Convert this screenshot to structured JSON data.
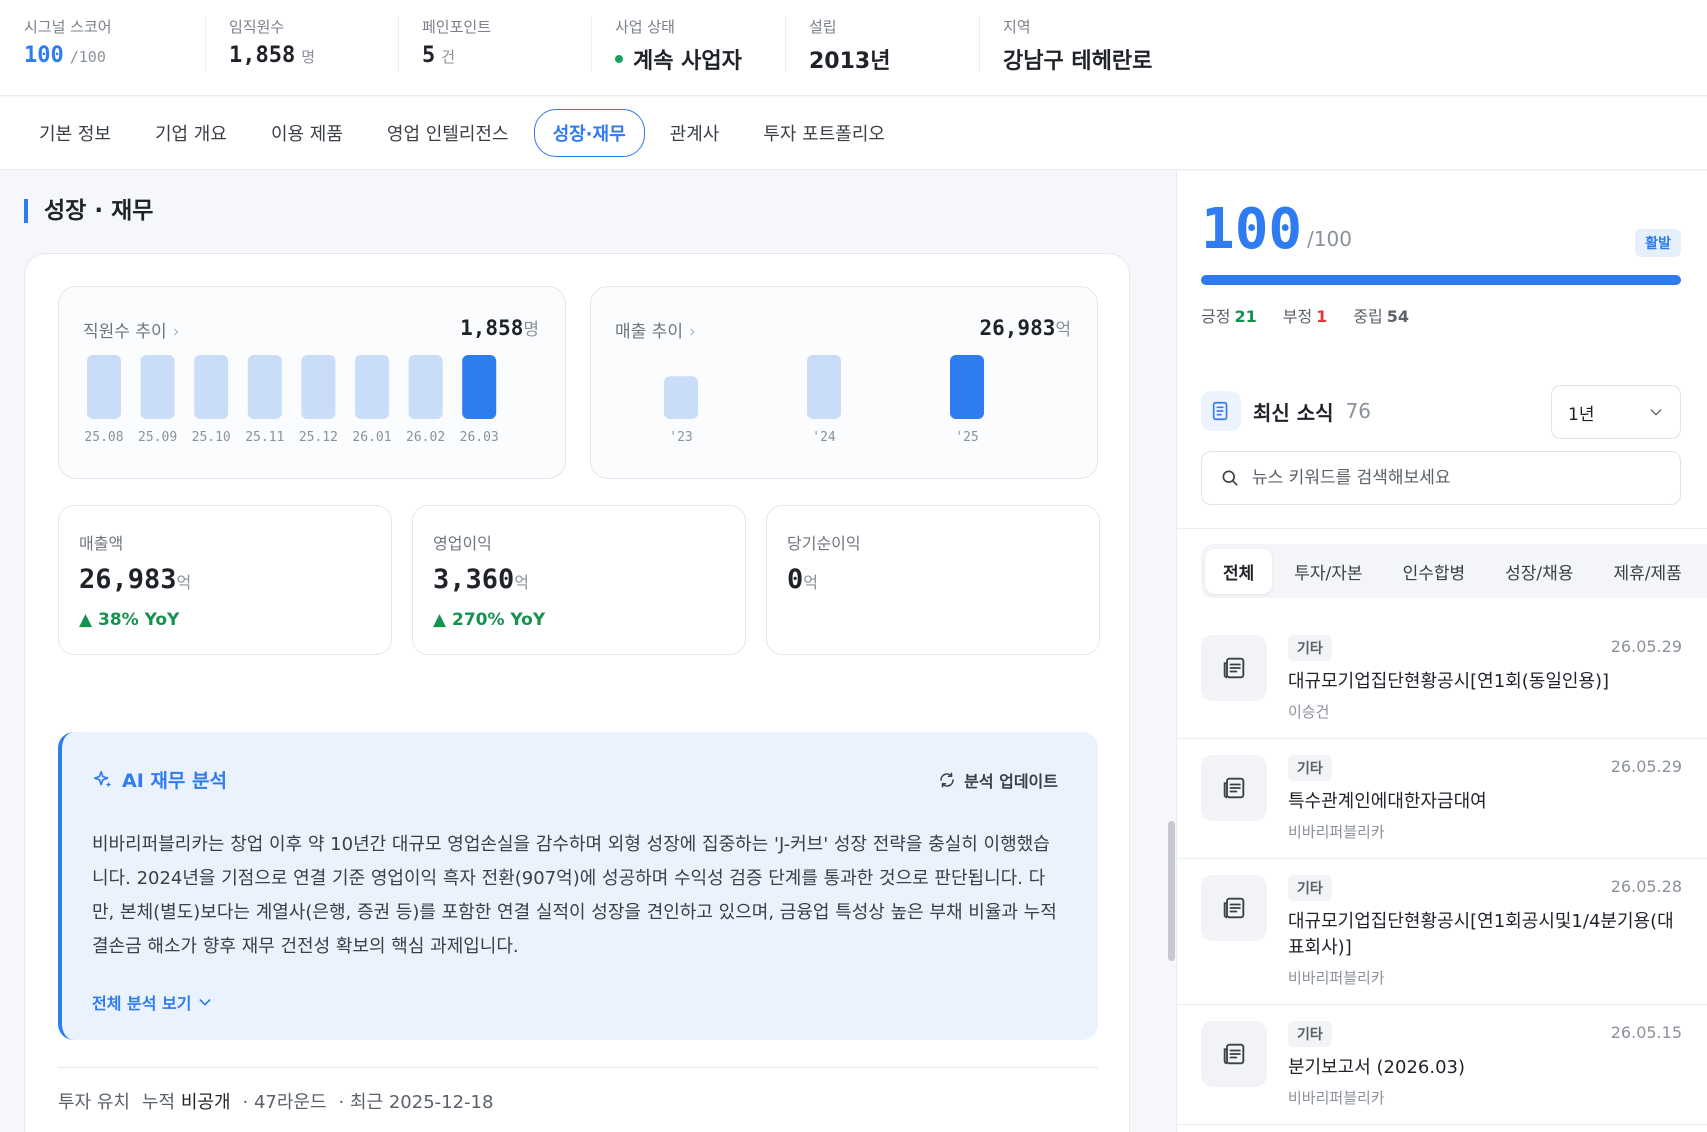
{
  "stats": [
    {
      "label": "시그널 스코어",
      "value": "100",
      "unit": "/100"
    },
    {
      "label": "임직원수",
      "value": "1,858",
      "unit": "명"
    },
    {
      "label": "페인포인트",
      "value": "5",
      "unit": "건"
    },
    {
      "label": "사업 상태",
      "value": "계속 사업자"
    },
    {
      "label": "설립",
      "value": "2013년"
    },
    {
      "label": "지역",
      "value": "강남구 테헤란로"
    }
  ],
  "tabs": [
    "기본 정보",
    "기업 개요",
    "이용 제품",
    "영업 인텔리전스",
    "성장·재무",
    "관계사",
    "투자 포트폴리오"
  ],
  "section_title": "성장 · 재무",
  "employee_trend": {
    "title": "직원수 추이",
    "total": "1,858",
    "unit": "명",
    "chart_data": {
      "type": "bar",
      "categories": [
        "25.08",
        "25.09",
        "25.10",
        "25.11",
        "25.12",
        "26.01",
        "26.02",
        "26.03"
      ],
      "values": [
        1858,
        1858,
        1858,
        1858,
        1858,
        1858,
        1858,
        1858
      ],
      "highlight_last": true
    }
  },
  "revenue_trend": {
    "title": "매출 추이",
    "total": "26,983",
    "unit": "억",
    "chart_data": {
      "type": "bar",
      "categories": [
        "'23",
        "'24",
        "'25"
      ],
      "values": [
        18000,
        26983,
        26983
      ],
      "highlight_last": true
    }
  },
  "metrics": [
    {
      "label": "매출액",
      "value": "26,983",
      "unit": "억",
      "yoy": "▲ 38% YoY"
    },
    {
      "label": "영업이익",
      "value": "3,360",
      "unit": "억",
      "yoy": "▲ 270% YoY"
    },
    {
      "label": "당기순이익",
      "value": "0",
      "unit": "억",
      "yoy": ""
    }
  ],
  "ai": {
    "title": "AI 재무 분석",
    "update_label": "분석 업데이트",
    "body": "비바리퍼블리카는 창업 이후 약 10년간 대규모 영업손실을 감수하며 외형 성장에 집중하는 'J-커브' 성장 전략을 충실히 이행했습니다. 2024년을 기점으로 연결 기준 영업이익 흑자 전환(907억)에 성공하며 수익성 검증 단계를 통과한 것으로 판단됩니다. 다만, 본체(별도)보다는 계열사(은행, 증권 등)를 포함한 연결 실적이 성장을 견인하고 있으며, 금융업 특성상 높은 부채 비율과 누적 결손금 해소가 향후 재무 건전성 확보의 핵심 과제입니다.",
    "more_label": "전체 분석 보기"
  },
  "investment": {
    "label": "투자 유치",
    "cumulative_label": "누적",
    "cumulative_value": "비공개",
    "rounds": "· 47라운드",
    "latest": "· 최근 2025-12-18"
  },
  "score": {
    "value": "100",
    "max": "/100",
    "badge": "활발",
    "fill_ratio": 1.0,
    "positive_label": "긍정",
    "positive": "21",
    "negative_label": "부정",
    "negative": "1",
    "neutral_label": "중립",
    "neutral": "54"
  },
  "news": {
    "title": "최신 소식",
    "count": "76",
    "period": "1년",
    "search_placeholder": "뉴스 키워드를 검색해보세요",
    "categories": [
      "전체",
      "투자/자본",
      "인수합병",
      "성장/채용",
      "제휴/제품"
    ],
    "items": [
      {
        "tag": "기타",
        "date": "26.05.29",
        "headline": "대규모기업집단현황공시[연1회(동일인용)]",
        "source": "이승건"
      },
      {
        "tag": "기타",
        "date": "26.05.29",
        "headline": "특수관계인에대한자금대여",
        "source": "비바리퍼블리카"
      },
      {
        "tag": "기타",
        "date": "26.05.28",
        "headline": "대규모기업집단현황공시[연1회공시및1/4분기용(대표회사)]",
        "source": "비바리퍼블리카"
      },
      {
        "tag": "기타",
        "date": "26.05.15",
        "headline": "분기보고서 (2026.03)",
        "source": "비바리퍼블리카"
      }
    ]
  },
  "colors": {
    "accent": "#2f7bf0",
    "bar_light": "#c9dcf8",
    "positive": "#14924f",
    "negative": "#e03a3a"
  }
}
